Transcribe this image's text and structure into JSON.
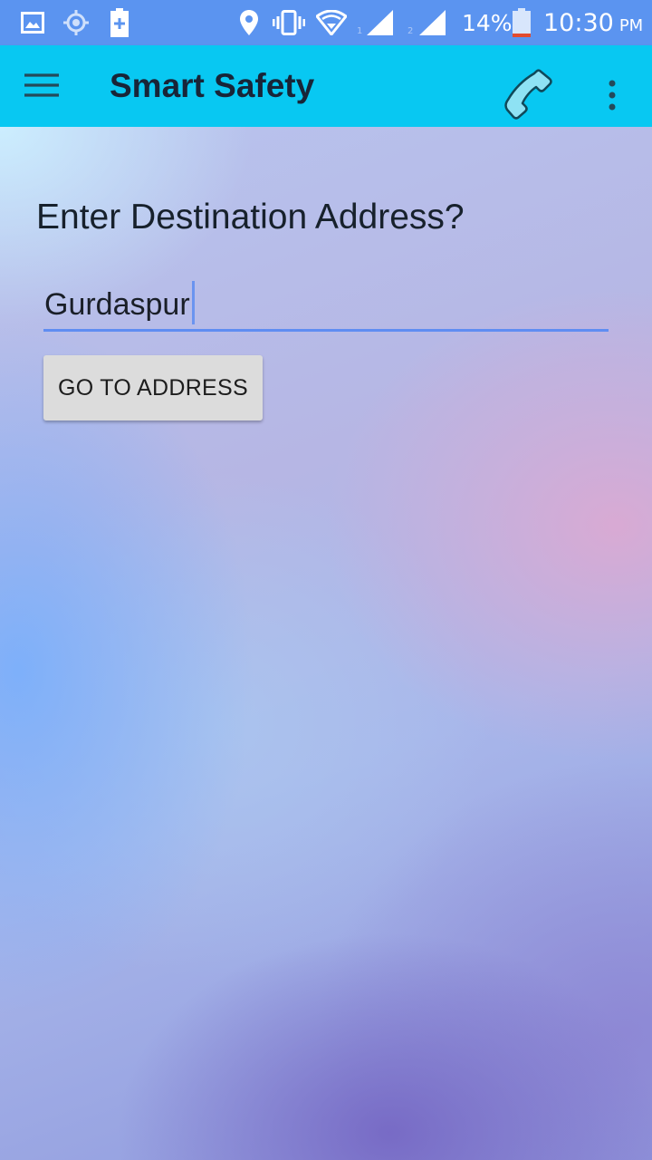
{
  "status_bar": {
    "battery_percent": "14%",
    "time": "10:30",
    "ampm": "PM",
    "sim1_label": "1",
    "sim2_label": "2",
    "icons": [
      "gallery-icon",
      "gps-icon",
      "battery-saver-icon",
      "location-icon",
      "vibrate-icon",
      "wifi-icon",
      "signal-icon",
      "signal-icon",
      "battery-icon"
    ]
  },
  "app_bar": {
    "title": "Smart Safety",
    "menu_icon": "menu-icon",
    "call_icon": "phone-icon",
    "overflow_icon": "more-vert-icon"
  },
  "main": {
    "prompt": "Enter Destination Address?",
    "address_value": "Gurdaspur",
    "go_button_label": "GO TO ADDRESS"
  },
  "colors": {
    "status_bar": "#5b94f0",
    "app_bar": "#08c8f2",
    "title_text": "#182538",
    "field_underline": "#5f8df2",
    "button_bg": "#dcdcdc"
  }
}
